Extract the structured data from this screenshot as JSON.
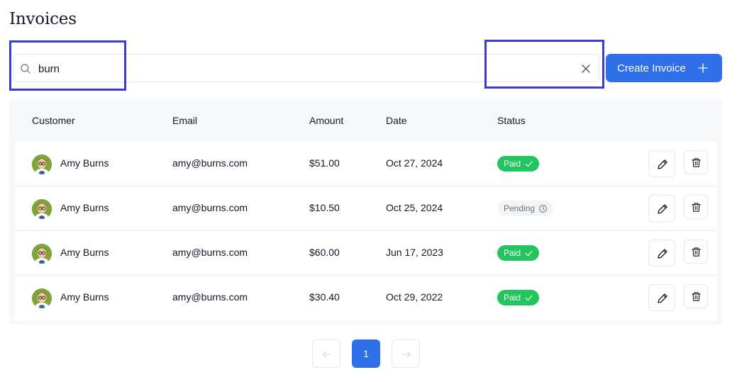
{
  "page": {
    "title": "Invoices"
  },
  "search": {
    "value": "burn",
    "placeholder": ""
  },
  "toolbar": {
    "create_label": "Create Invoice"
  },
  "table": {
    "headers": {
      "customer": "Customer",
      "email": "Email",
      "amount": "Amount",
      "date": "Date",
      "status": "Status"
    },
    "rows": [
      {
        "customer": "Amy Burns",
        "email": "amy@burns.com",
        "amount": "$51.00",
        "date": "Oct 27, 2024",
        "status": "Paid",
        "status_type": "paid"
      },
      {
        "customer": "Amy Burns",
        "email": "amy@burns.com",
        "amount": "$10.50",
        "date": "Oct 25, 2024",
        "status": "Pending",
        "status_type": "pending"
      },
      {
        "customer": "Amy Burns",
        "email": "amy@burns.com",
        "amount": "$60.00",
        "date": "Jun 17, 2023",
        "status": "Paid",
        "status_type": "paid"
      },
      {
        "customer": "Amy Burns",
        "email": "amy@burns.com",
        "amount": "$30.40",
        "date": "Oct 29, 2022",
        "status": "Paid",
        "status_type": "paid"
      }
    ]
  },
  "pagination": {
    "current_page": "1"
  },
  "colors": {
    "accent": "#2f6fe8",
    "paid": "#22c55e",
    "pending_bg": "#f3f4f6",
    "highlight": "#3b3bdb"
  },
  "icons": {
    "search": "search-icon",
    "clear": "close-icon",
    "add": "plus-icon",
    "edit": "pencil-icon",
    "delete": "trash-icon",
    "paid": "check-icon",
    "pending": "clock-icon",
    "prev": "arrow-left-icon",
    "next": "arrow-right-icon"
  }
}
